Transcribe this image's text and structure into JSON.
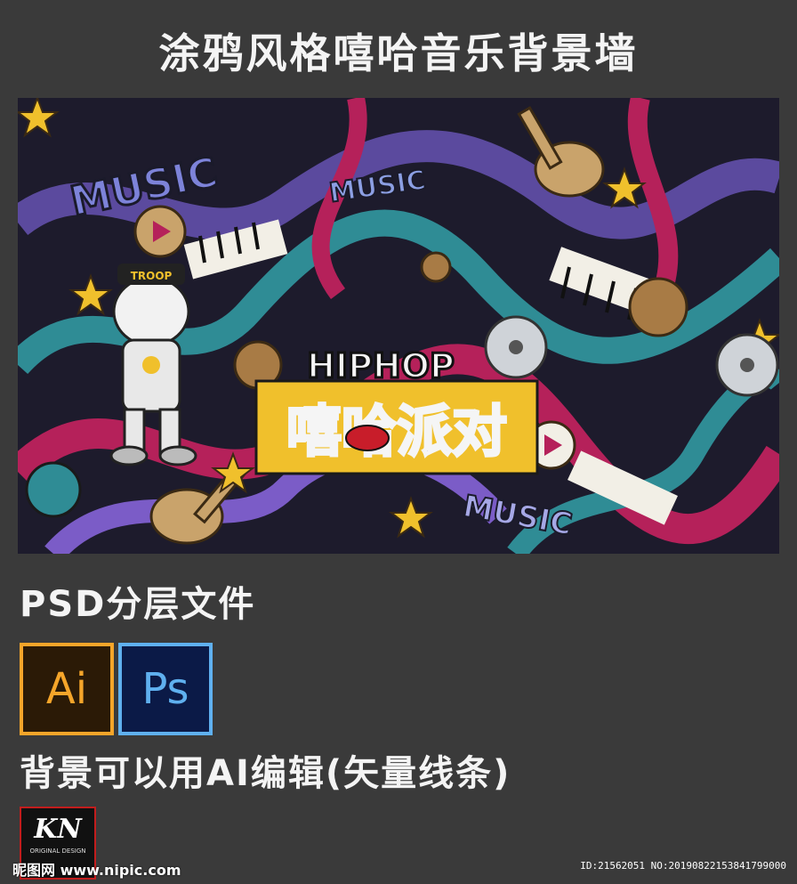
{
  "page": {
    "title": "涂鸦风格嘻哈音乐背景墙",
    "file_type": "PSD分层文件",
    "edit_note": "背景可以用AI编辑(矢量线条)"
  },
  "poster": {
    "music_text_1": "MUSIC",
    "music_text_2": "MUSIC",
    "music_text_3": "MUSIC",
    "cap_text": "TROOP",
    "hiphop_text": "HIPHOP",
    "party_text": "嘻哈派对",
    "colors": {
      "purple": "#5b4a9e",
      "magenta": "#b5215a",
      "teal": "#2f8c95",
      "yellow": "#f0c02c",
      "dark": "#1d1b2c"
    }
  },
  "badges": {
    "ai_label": "Ai",
    "ps_label": "Ps",
    "ai_color": "#f5a52a",
    "ps_color": "#5fb0ef"
  },
  "logo": {
    "text": "KN",
    "sub": "ORIGINAL DESIGN"
  },
  "watermark": {
    "left": "昵图网 www.nipic.com",
    "right": "ID:21562051 NO:20190822153841799000"
  }
}
